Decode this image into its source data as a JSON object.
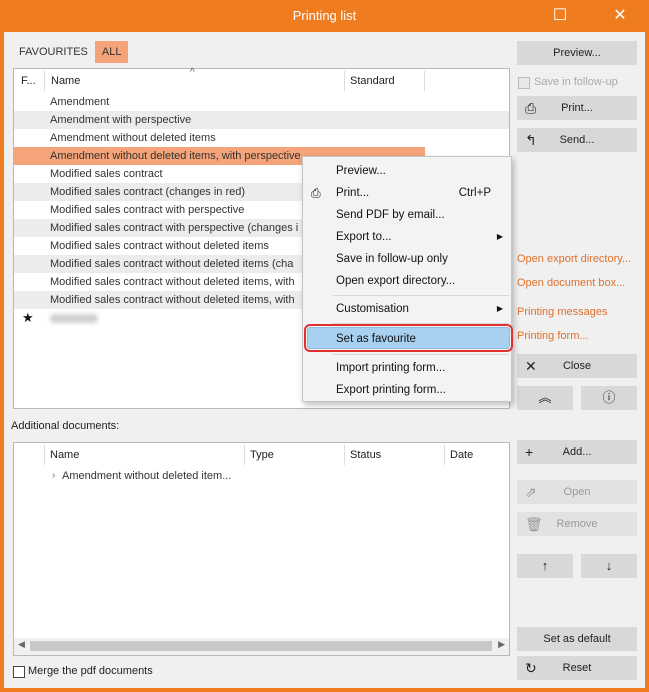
{
  "window": {
    "title": "Printing list"
  },
  "tabs": [
    {
      "label": "FAVOURITES"
    },
    {
      "label": "ALL"
    }
  ],
  "list": {
    "columns": {
      "fav": "F...",
      "name": "Name",
      "standard": "Standard"
    },
    "rows": [
      "Amendment",
      "Amendment with perspective",
      "Amendment without deleted items",
      "Amendment without deleted items, with perspective",
      "Modified sales contract",
      "Modified sales contract (changes in red)",
      "Modified sales contract with perspective",
      "Modified sales contract with perspective (changes i",
      "Modified sales contract without deleted items",
      "Modified sales contract without deleted items (cha",
      "Modified sales contract without deleted items, with",
      "Modified sales contract without deleted items, with"
    ],
    "favourite_star": "★"
  },
  "context_menu": {
    "preview": "Preview...",
    "print": "Print...",
    "print_shortcut": "Ctrl+P",
    "send_pdf": "Send PDF by email...",
    "export_to": "Export to...",
    "save_followup": "Save in follow-up only",
    "open_export_dir": "Open export directory...",
    "customisation": "Customisation",
    "set_favourite": "Set as favourite",
    "import_form": "Import printing form...",
    "export_form": "Export printing form..."
  },
  "additional": {
    "label": "Additional documents:",
    "columns": {
      "name": "Name",
      "type": "Type",
      "status": "Status",
      "date": "Date"
    },
    "rows": [
      {
        "name": "Amendment without deleted item..."
      }
    ]
  },
  "merge_label": "Merge the pdf documents",
  "side": {
    "preview": "Preview...",
    "save_followup": "Save in follow-up",
    "print": "Print...",
    "send": "Send...",
    "open_export_dir": "Open export directory...",
    "open_doc_box": "Open document box...",
    "printing_messages": "Printing messages",
    "printing_form": "Printing form...",
    "close": "Close",
    "add": "Add...",
    "open": "Open",
    "remove": "Remove",
    "set_default": "Set as default",
    "reset": "Reset"
  },
  "colors": {
    "accent": "#f07c20",
    "selection": "#f4a478",
    "link": "#e0702a",
    "highlight": "#a8d0f0"
  }
}
